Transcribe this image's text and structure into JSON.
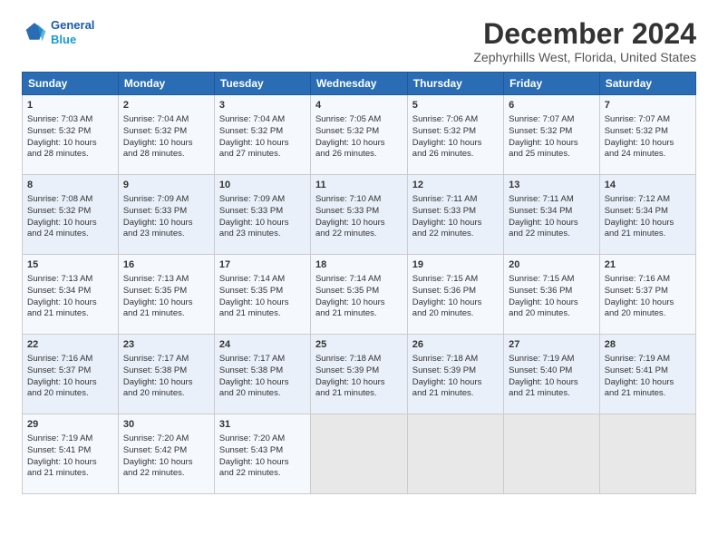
{
  "logo": {
    "line1": "General",
    "line2": "Blue"
  },
  "title": "December 2024",
  "subtitle": "Zephyrhills West, Florida, United States",
  "days_of_week": [
    "Sunday",
    "Monday",
    "Tuesday",
    "Wednesday",
    "Thursday",
    "Friday",
    "Saturday"
  ],
  "weeks": [
    [
      {
        "day": "1",
        "content": "Sunrise: 7:03 AM\nSunset: 5:32 PM\nDaylight: 10 hours\nand 28 minutes."
      },
      {
        "day": "2",
        "content": "Sunrise: 7:04 AM\nSunset: 5:32 PM\nDaylight: 10 hours\nand 28 minutes."
      },
      {
        "day": "3",
        "content": "Sunrise: 7:04 AM\nSunset: 5:32 PM\nDaylight: 10 hours\nand 27 minutes."
      },
      {
        "day": "4",
        "content": "Sunrise: 7:05 AM\nSunset: 5:32 PM\nDaylight: 10 hours\nand 26 minutes."
      },
      {
        "day": "5",
        "content": "Sunrise: 7:06 AM\nSunset: 5:32 PM\nDaylight: 10 hours\nand 26 minutes."
      },
      {
        "day": "6",
        "content": "Sunrise: 7:07 AM\nSunset: 5:32 PM\nDaylight: 10 hours\nand 25 minutes."
      },
      {
        "day": "7",
        "content": "Sunrise: 7:07 AM\nSunset: 5:32 PM\nDaylight: 10 hours\nand 24 minutes."
      }
    ],
    [
      {
        "day": "8",
        "content": "Sunrise: 7:08 AM\nSunset: 5:32 PM\nDaylight: 10 hours\nand 24 minutes."
      },
      {
        "day": "9",
        "content": "Sunrise: 7:09 AM\nSunset: 5:33 PM\nDaylight: 10 hours\nand 23 minutes."
      },
      {
        "day": "10",
        "content": "Sunrise: 7:09 AM\nSunset: 5:33 PM\nDaylight: 10 hours\nand 23 minutes."
      },
      {
        "day": "11",
        "content": "Sunrise: 7:10 AM\nSunset: 5:33 PM\nDaylight: 10 hours\nand 22 minutes."
      },
      {
        "day": "12",
        "content": "Sunrise: 7:11 AM\nSunset: 5:33 PM\nDaylight: 10 hours\nand 22 minutes."
      },
      {
        "day": "13",
        "content": "Sunrise: 7:11 AM\nSunset: 5:34 PM\nDaylight: 10 hours\nand 22 minutes."
      },
      {
        "day": "14",
        "content": "Sunrise: 7:12 AM\nSunset: 5:34 PM\nDaylight: 10 hours\nand 21 minutes."
      }
    ],
    [
      {
        "day": "15",
        "content": "Sunrise: 7:13 AM\nSunset: 5:34 PM\nDaylight: 10 hours\nand 21 minutes."
      },
      {
        "day": "16",
        "content": "Sunrise: 7:13 AM\nSunset: 5:35 PM\nDaylight: 10 hours\nand 21 minutes."
      },
      {
        "day": "17",
        "content": "Sunrise: 7:14 AM\nSunset: 5:35 PM\nDaylight: 10 hours\nand 21 minutes."
      },
      {
        "day": "18",
        "content": "Sunrise: 7:14 AM\nSunset: 5:35 PM\nDaylight: 10 hours\nand 21 minutes."
      },
      {
        "day": "19",
        "content": "Sunrise: 7:15 AM\nSunset: 5:36 PM\nDaylight: 10 hours\nand 20 minutes."
      },
      {
        "day": "20",
        "content": "Sunrise: 7:15 AM\nSunset: 5:36 PM\nDaylight: 10 hours\nand 20 minutes."
      },
      {
        "day": "21",
        "content": "Sunrise: 7:16 AM\nSunset: 5:37 PM\nDaylight: 10 hours\nand 20 minutes."
      }
    ],
    [
      {
        "day": "22",
        "content": "Sunrise: 7:16 AM\nSunset: 5:37 PM\nDaylight: 10 hours\nand 20 minutes."
      },
      {
        "day": "23",
        "content": "Sunrise: 7:17 AM\nSunset: 5:38 PM\nDaylight: 10 hours\nand 20 minutes."
      },
      {
        "day": "24",
        "content": "Sunrise: 7:17 AM\nSunset: 5:38 PM\nDaylight: 10 hours\nand 20 minutes."
      },
      {
        "day": "25",
        "content": "Sunrise: 7:18 AM\nSunset: 5:39 PM\nDaylight: 10 hours\nand 21 minutes."
      },
      {
        "day": "26",
        "content": "Sunrise: 7:18 AM\nSunset: 5:39 PM\nDaylight: 10 hours\nand 21 minutes."
      },
      {
        "day": "27",
        "content": "Sunrise: 7:19 AM\nSunset: 5:40 PM\nDaylight: 10 hours\nand 21 minutes."
      },
      {
        "day": "28",
        "content": "Sunrise: 7:19 AM\nSunset: 5:41 PM\nDaylight: 10 hours\nand 21 minutes."
      }
    ],
    [
      {
        "day": "29",
        "content": "Sunrise: 7:19 AM\nSunset: 5:41 PM\nDaylight: 10 hours\nand 21 minutes."
      },
      {
        "day": "30",
        "content": "Sunrise: 7:20 AM\nSunset: 5:42 PM\nDaylight: 10 hours\nand 22 minutes."
      },
      {
        "day": "31",
        "content": "Sunrise: 7:20 AM\nSunset: 5:43 PM\nDaylight: 10 hours\nand 22 minutes."
      },
      {
        "day": "",
        "content": ""
      },
      {
        "day": "",
        "content": ""
      },
      {
        "day": "",
        "content": ""
      },
      {
        "day": "",
        "content": ""
      }
    ]
  ]
}
